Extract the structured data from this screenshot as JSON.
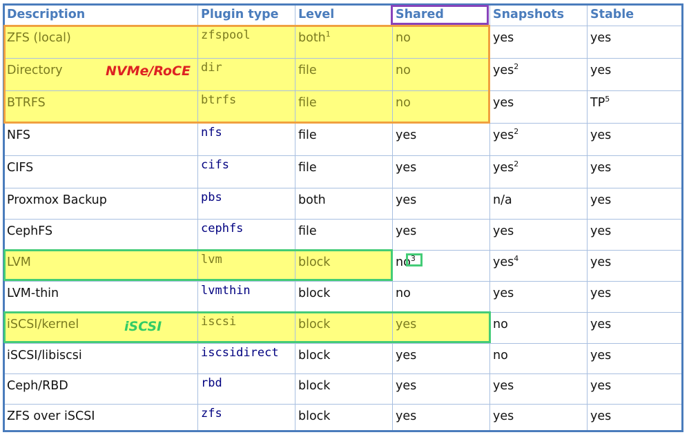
{
  "colors": {
    "header_text": "#4a7cbc",
    "border": "#4a7cbc",
    "grid": "#a8bfe0",
    "highlight": "#ffff80",
    "orange_box": "#f0a040",
    "green_box": "#44cc77",
    "purple_box": "#8844bb",
    "nvme_label": "#dd2222",
    "iscsi_label": "#33cc66"
  },
  "headers": [
    "Description",
    "Plugin type",
    "Level",
    "Shared",
    "Snapshots",
    "Stable"
  ],
  "rows": [
    {
      "desc": "ZFS (local)",
      "plugin": "zfspool",
      "level": "both",
      "level_sup": "1",
      "shared": "no",
      "shared_sup": "",
      "snap": "yes",
      "snap_sup": "",
      "stable": "yes",
      "stable_sup": ""
    },
    {
      "desc": "Directory",
      "plugin": "dir",
      "level": "file",
      "level_sup": "",
      "shared": "no",
      "shared_sup": "",
      "snap": "yes",
      "snap_sup": "2",
      "stable": "yes",
      "stable_sup": ""
    },
    {
      "desc": "BTRFS",
      "plugin": "btrfs",
      "level": "file",
      "level_sup": "",
      "shared": "no",
      "shared_sup": "",
      "snap": "yes",
      "snap_sup": "",
      "stable": "TP",
      "stable_sup": "5"
    },
    {
      "desc": "NFS",
      "plugin": "nfs",
      "level": "file",
      "level_sup": "",
      "shared": "yes",
      "shared_sup": "",
      "snap": "yes",
      "snap_sup": "2",
      "stable": "yes",
      "stable_sup": ""
    },
    {
      "desc": "CIFS",
      "plugin": "cifs",
      "level": "file",
      "level_sup": "",
      "shared": "yes",
      "shared_sup": "",
      "snap": "yes",
      "snap_sup": "2",
      "stable": "yes",
      "stable_sup": ""
    },
    {
      "desc": "Proxmox Backup",
      "plugin": "pbs",
      "level": "both",
      "level_sup": "",
      "shared": "yes",
      "shared_sup": "",
      "snap": "n/a",
      "snap_sup": "",
      "stable": "yes",
      "stable_sup": ""
    },
    {
      "desc": "CephFS",
      "plugin": "cephfs",
      "level": "file",
      "level_sup": "",
      "shared": "yes",
      "shared_sup": "",
      "snap": "yes",
      "snap_sup": "",
      "stable": "yes",
      "stable_sup": ""
    },
    {
      "desc": "LVM",
      "plugin": "lvm",
      "level": "block",
      "level_sup": "",
      "shared": "no",
      "shared_sup": "3",
      "snap": "yes",
      "snap_sup": "4",
      "stable": "yes",
      "stable_sup": ""
    },
    {
      "desc": "LVM-thin",
      "plugin": "lvmthin",
      "level": "block",
      "level_sup": "",
      "shared": "no",
      "shared_sup": "",
      "snap": "yes",
      "snap_sup": "",
      "stable": "yes",
      "stable_sup": ""
    },
    {
      "desc": "iSCSI/kernel",
      "plugin": "iscsi",
      "level": "block",
      "level_sup": "",
      "shared": "yes",
      "shared_sup": "",
      "snap": "no",
      "snap_sup": "",
      "stable": "yes",
      "stable_sup": ""
    },
    {
      "desc": "iSCSI/libiscsi",
      "plugin": "iscsidirect",
      "level": "block",
      "level_sup": "",
      "shared": "yes",
      "shared_sup": "",
      "snap": "no",
      "snap_sup": "",
      "stable": "yes",
      "stable_sup": ""
    },
    {
      "desc": "Ceph/RBD",
      "plugin": "rbd",
      "level": "block",
      "level_sup": "",
      "shared": "yes",
      "shared_sup": "",
      "snap": "yes",
      "snap_sup": "",
      "stable": "yes",
      "stable_sup": ""
    },
    {
      "desc": "ZFS over iSCSI",
      "plugin": "zfs",
      "level": "block",
      "level_sup": "",
      "shared": "yes",
      "shared_sup": "",
      "snap": "yes",
      "snap_sup": "",
      "stable": "yes",
      "stable_sup": ""
    }
  ],
  "annotations": {
    "nvme_label": "NVMe/RoCE",
    "iscsi_label": "iSCSI"
  }
}
